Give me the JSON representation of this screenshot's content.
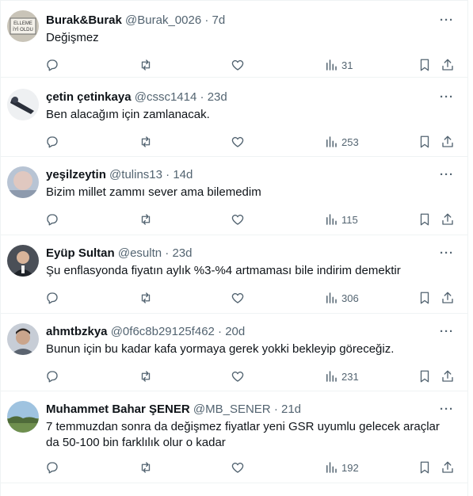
{
  "colors": {
    "text": "#0f1419",
    "secondary": "#536471",
    "border": "#eff3f4"
  },
  "icons": {
    "more": "more-horizontal-icon",
    "reply": "reply-icon",
    "retweet": "retweet-icon",
    "like": "heart-icon",
    "views": "views-chart-icon",
    "bookmark": "bookmark-icon",
    "share": "share-icon"
  },
  "more_glyph": "···",
  "tweets": [
    {
      "name": "Burak&Burak",
      "handle": "@Burak_0026",
      "separator": "·",
      "time": "7d",
      "text": "Değişmez",
      "views": "31",
      "avatar_text": [
        "ELLEME",
        "İYİ OLDU"
      ]
    },
    {
      "name": "çetin çetinkaya",
      "handle": "@cssc1414",
      "separator": "·",
      "time": "23d",
      "text": "Ben alacağım için zamlanacak.",
      "views": "253"
    },
    {
      "name": "yeşilzeytin",
      "handle": "@tulins13",
      "separator": "·",
      "time": "14d",
      "text": "Bizim millet zammı sever ama bilemedim",
      "views": "115"
    },
    {
      "name": "Eyüp Sultan",
      "handle": "@esultn",
      "separator": "·",
      "time": "23d",
      "text": "Şu enflasyonda fiyatın aylık %3-%4 artmaması bile indirim demektir",
      "views": "306"
    },
    {
      "name": "ahmtbzkya",
      "handle": "@0f6c8b29125f462",
      "separator": "·",
      "time": "20d",
      "text": "Bunun için bu kadar kafa yormaya gerek yokki bekleyip göreceğiz.",
      "views": "231"
    },
    {
      "name": "Muhammet Bahar ŞENER",
      "handle": "@MB_SENER",
      "separator": "·",
      "time": "21d",
      "text": "7 temmuzdan sonra da değişmez fiyatlar yeni GSR uyumlu gelecek araçlar da 50-100 bin farklılık olur o kadar",
      "views": "192"
    }
  ]
}
